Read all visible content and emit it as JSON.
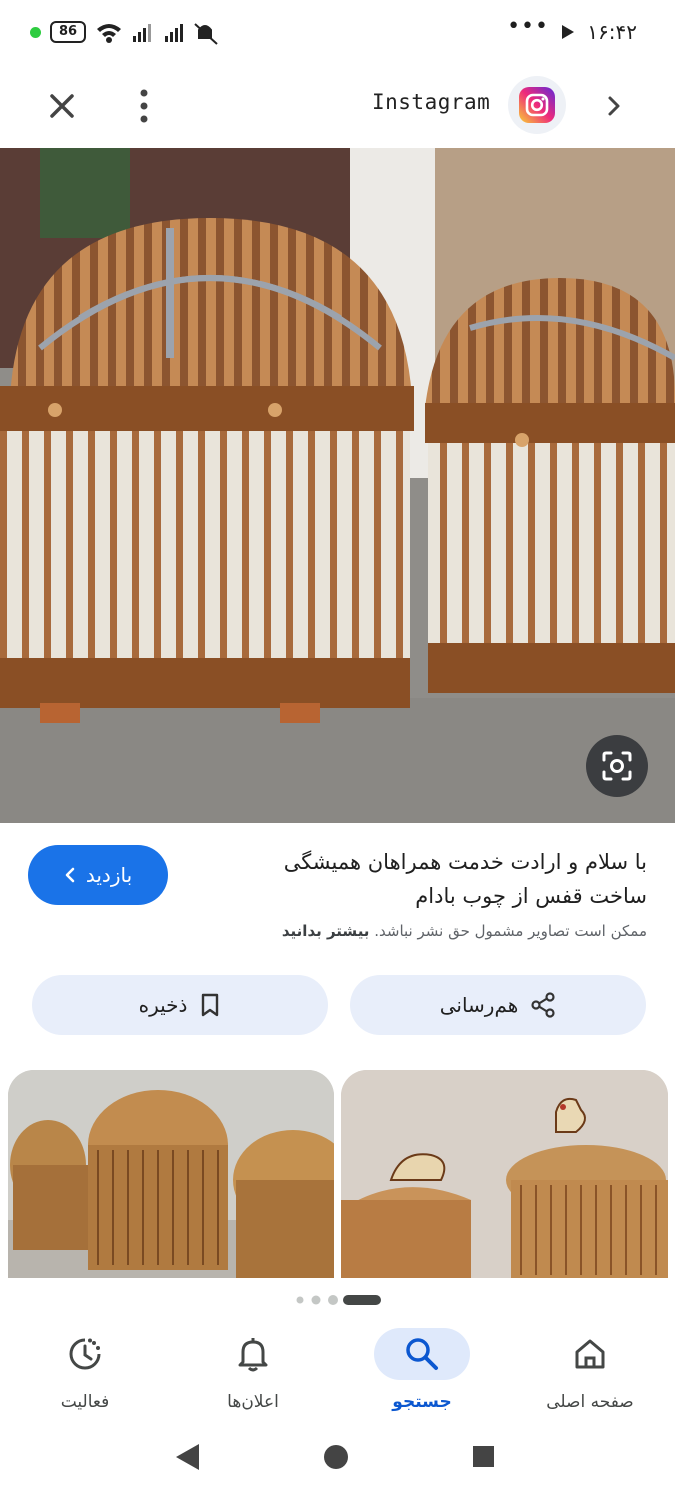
{
  "status_bar": {
    "time": "۱۶:۴۲",
    "battery": "86",
    "overflow": "•••"
  },
  "header": {
    "source_name": "Instagram"
  },
  "result": {
    "visit_label": "بازدید",
    "title": "با سلام و ارادت خدمت همراهان همیشگی ساخت قفس از چوب بادام",
    "disclaimer": "ممکن است تصاویر مشمول حق نشر نباشد.",
    "learn_more": "بیشتر بدانید",
    "share_label": "هم‌رسانی",
    "save_label": "ذخیره"
  },
  "pager": {
    "count": 4,
    "active_index": 3
  },
  "bottom_nav": {
    "items": [
      {
        "label": "فعالیت",
        "icon": "activity-icon"
      },
      {
        "label": "اعلان‌ها",
        "icon": "bell-icon"
      },
      {
        "label": "جستجو",
        "icon": "search-icon"
      },
      {
        "label": "صفحه اصلی",
        "icon": "home-icon"
      }
    ],
    "active": "جستجو"
  },
  "colors": {
    "accent": "#1a73e8",
    "pill_bg": "#e8eefa",
    "nav_active_bg": "#dfe9fb",
    "nav_active_text": "#0b57d0"
  }
}
